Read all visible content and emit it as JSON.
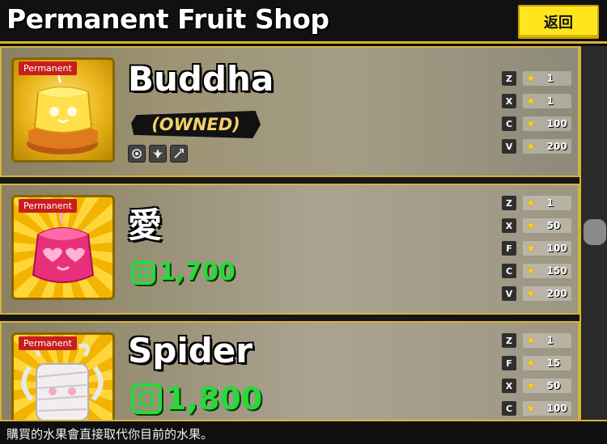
{
  "header": {
    "title": "Permanent Fruit Shop",
    "back_label": "返回"
  },
  "cards": [
    {
      "badge": "Permanent",
      "name": "Buddha",
      "owned_label": "(OWNED)",
      "ability_icons": [
        "dot-icon",
        "flame-icon",
        "sweep-icon"
      ],
      "moves": [
        {
          "key": "Z",
          "level": "1"
        },
        {
          "key": "X",
          "level": "1"
        },
        {
          "key": "C",
          "level": "100"
        },
        {
          "key": "V",
          "level": "200"
        }
      ]
    },
    {
      "badge": "Permanent",
      "name": "愛",
      "price": "1,700",
      "moves": [
        {
          "key": "Z",
          "level": "1"
        },
        {
          "key": "X",
          "level": "50"
        },
        {
          "key": "F",
          "level": "100"
        },
        {
          "key": "C",
          "level": "150"
        },
        {
          "key": "V",
          "level": "200"
        }
      ]
    },
    {
      "badge": "Permanent",
      "name": "Spider",
      "price": "1,800",
      "moves": [
        {
          "key": "Z",
          "level": "1"
        },
        {
          "key": "F",
          "level": "15"
        },
        {
          "key": "X",
          "level": "50"
        },
        {
          "key": "C",
          "level": "100"
        }
      ]
    }
  ],
  "footer": {
    "note": "購買的水果會直接取代你目前的水果。"
  },
  "colors": {
    "accent": "#d8b23a",
    "button": "#ffe51e",
    "price": "#27d93a",
    "badge": "#c81e1e"
  }
}
